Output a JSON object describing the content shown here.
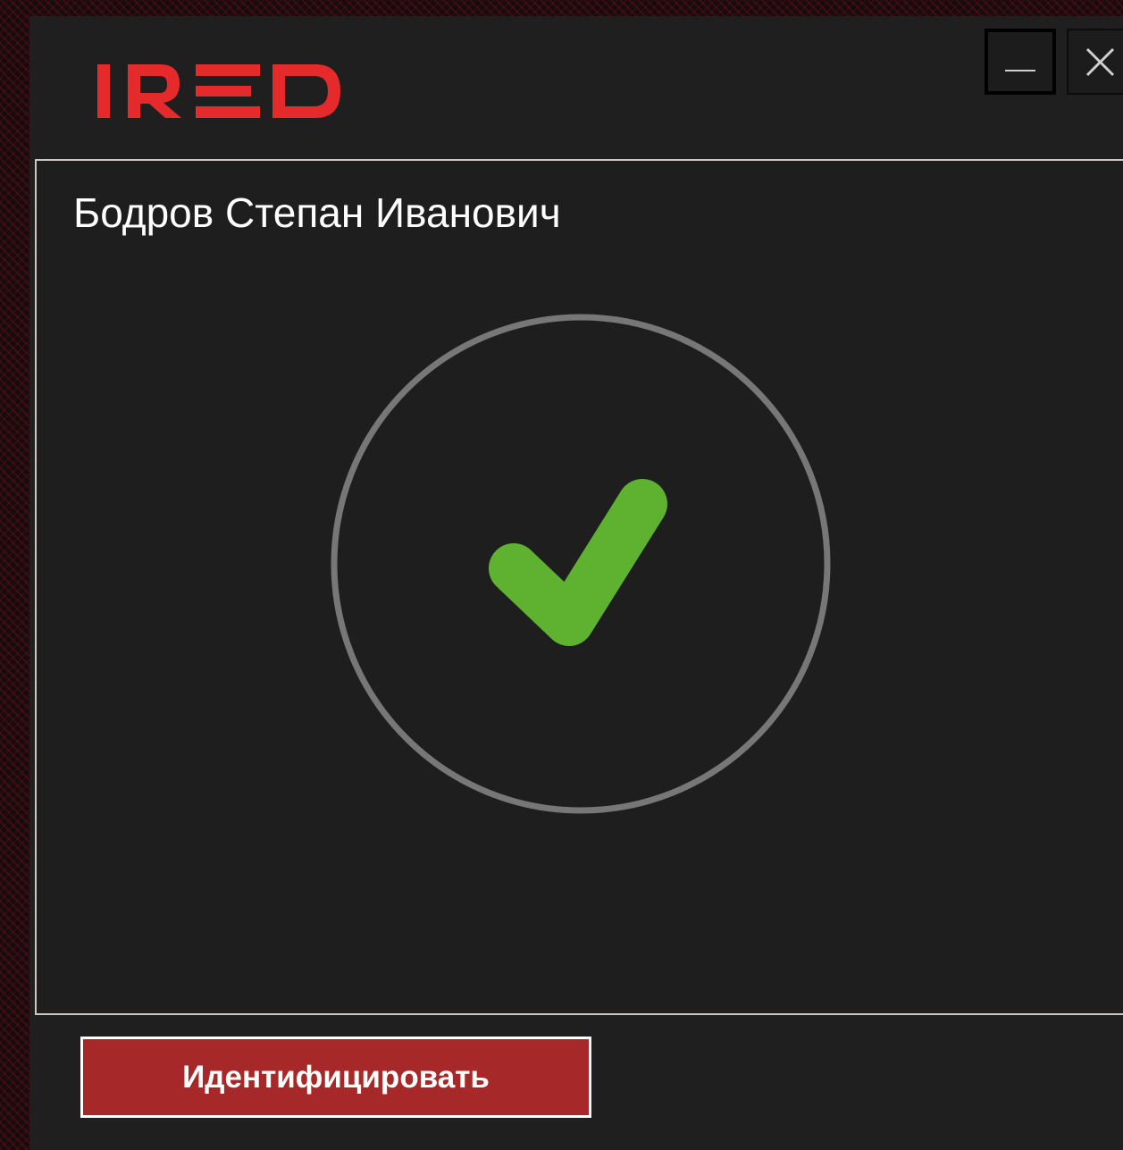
{
  "app": {
    "logo_text": "IRED",
    "logo_color": "#e42a2a"
  },
  "titlebar": {
    "minimize_icon": "minimize-icon",
    "close_icon": "close-icon"
  },
  "main": {
    "user_name": "Бодров Степан Иванович",
    "status_icon": "check-circle-icon",
    "status_color": "#5fb130",
    "circle_color": "#777777"
  },
  "footer": {
    "identify_label": "Идентифицировать",
    "button_color": "#a72828"
  }
}
